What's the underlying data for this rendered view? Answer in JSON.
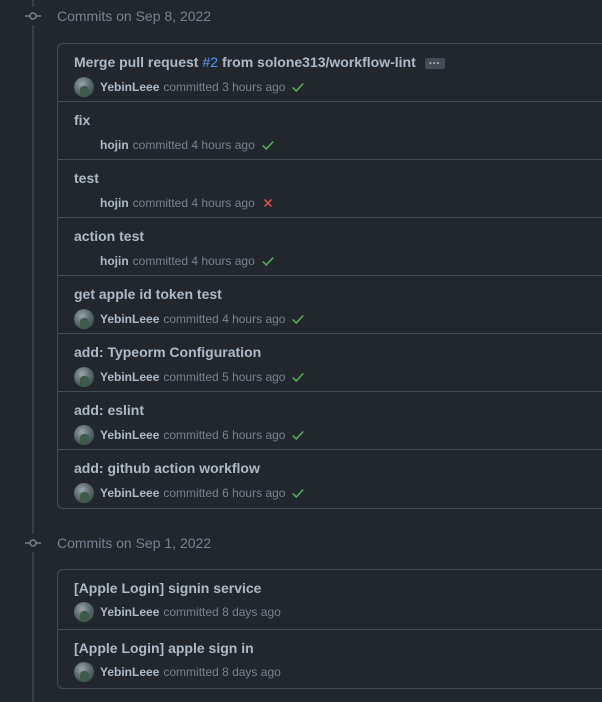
{
  "groups": [
    {
      "title": "Commits on Sep 8, 2022",
      "commits": [
        {
          "title_prefix": "Merge pull request",
          "pr": "#2",
          "title_suffix": "from solone313/workflow-lint",
          "has_ellipsis": true,
          "author": "YebinLeee",
          "avatar": true,
          "verb": "committed",
          "time": "3 hours ago",
          "status": "success"
        },
        {
          "title": "fix",
          "author": "hojin",
          "avatar": false,
          "verb": "committed",
          "time": "4 hours ago",
          "status": "success"
        },
        {
          "title": "test",
          "author": "hojin",
          "avatar": false,
          "verb": "committed",
          "time": "4 hours ago",
          "status": "failure"
        },
        {
          "title": "action test",
          "author": "hojin",
          "avatar": false,
          "verb": "committed",
          "time": "4 hours ago",
          "status": "success"
        },
        {
          "title": "get apple id token test",
          "author": "YebinLeee",
          "avatar": true,
          "verb": "committed",
          "time": "4 hours ago",
          "status": "success"
        },
        {
          "title": "add: Typeorm Configuration",
          "author": "YebinLeee",
          "avatar": true,
          "verb": "committed",
          "time": "5 hours ago",
          "status": "success"
        },
        {
          "title": "add: eslint",
          "author": "YebinLeee",
          "avatar": true,
          "verb": "committed",
          "time": "6 hours ago",
          "status": "success"
        },
        {
          "title": "add: github action workflow",
          "author": "YebinLeee",
          "avatar": true,
          "verb": "committed",
          "time": "6 hours ago",
          "status": "success"
        }
      ]
    },
    {
      "title": "Commits on Sep 1, 2022",
      "commits": [
        {
          "title": "[Apple Login] signin service",
          "author": "YebinLeee",
          "avatar": true,
          "verb": "committed",
          "time": "8 days ago",
          "status": "none"
        },
        {
          "title": "[Apple Login] apple sign in",
          "author": "YebinLeee",
          "avatar": true,
          "verb": "committed",
          "time": "8 days ago",
          "status": "none"
        }
      ]
    }
  ],
  "ellipsis_label": "…",
  "icons": {
    "commit": "git-commit-icon",
    "success": "check-icon",
    "failure": "x-icon"
  },
  "colors": {
    "success": "#57ab5a",
    "failure": "#e5534b",
    "link": "#539bf5"
  }
}
